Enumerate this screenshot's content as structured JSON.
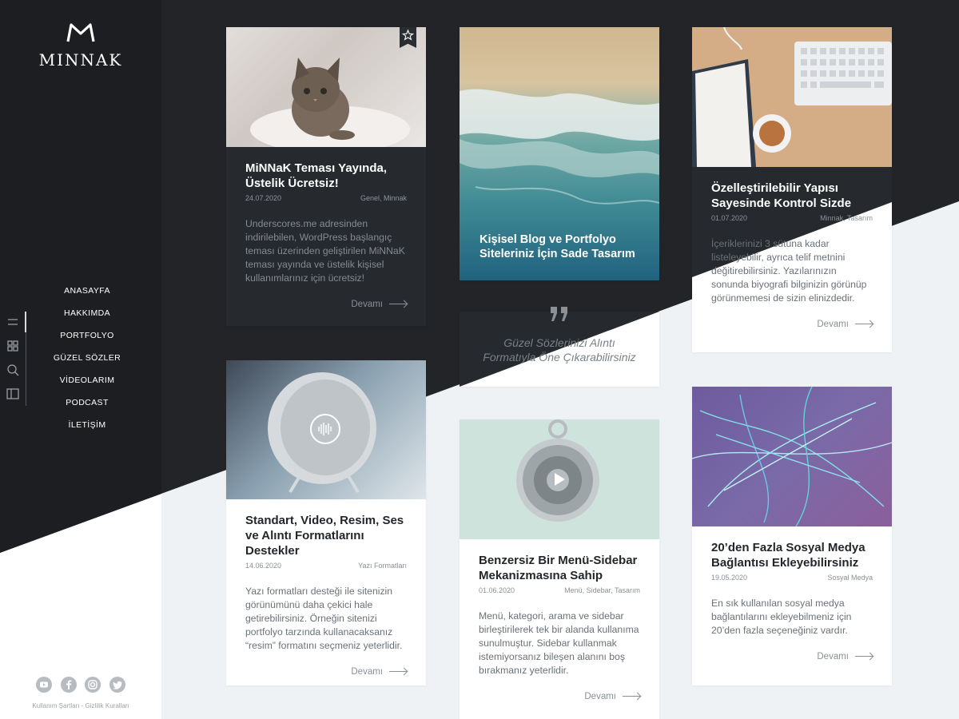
{
  "brand": {
    "name": "MINNAK"
  },
  "nav": [
    "ANASAYFA",
    "HAKKIMDA",
    "PORTFOLYO",
    "GÜZEL SÖZLER",
    "VİDEOLARIM",
    "PODCAST",
    "İLETİŞİM"
  ],
  "tools": [
    "menu-icon",
    "grid-icon",
    "search-icon",
    "sidebar-icon"
  ],
  "social": [
    "youtube-icon",
    "facebook-icon",
    "instagram-icon",
    "twitter-icon"
  ],
  "legal": "Kullanım Şartları - Gizlilik Kuralları",
  "more_label": "Devamı",
  "cards": {
    "c1": {
      "title": "MiNNaK Teması Yayında, Üstelik Ücretsiz!",
      "date": "24.07.2020",
      "cats": "Genel, Minnak",
      "excerpt": "Underscores.me adresinden indirilebilen, WordPress başlangıç teması üzerinden geliştirilen MiNNaK teması yayında ve üstelik kişisel kullanımlarınız için ücretsiz!"
    },
    "c2": {
      "title": "Kişisel Blog ve Portfolyo Siteleriniz İçin Sade Tasarım"
    },
    "c3": {
      "quote": "Güzel Sözlerinizi Alıntı Formatıyla Öne Çıkarabilirsiniz"
    },
    "c4": {
      "title": "Özelleştirilebilir Yapısı Sayesinde Kontrol Sizde",
      "date": "01.07.2020",
      "cats": "Minnak, Tasarım",
      "excerpt": "İçeriklerinizi 3 sütuna kadar listeleyebilir, ayrıca telif metnini değitirebilirsiniz. Yazılarınızın sonunda biyografi bilginizin görünüp görünmemesi de sizin elinizdedir."
    },
    "c5": {
      "title": "Standart, Video, Resim, Ses ve Alıntı Formatlarını Destekler",
      "date": "14.06.2020",
      "cats": "Yazı Formatları",
      "excerpt": "Yazı formatları desteği ile sitenizin görünümünü daha çekici hale getirebilirsiniz. Örneğin sitenizi portfolyo tarzında kullanacaksanız “resim” formatını seçmeniz yeterlidir."
    },
    "c6": {
      "title": "Benzersiz Bir Menü-Sidebar Mekanizmasına Sahip",
      "date": "01.06.2020",
      "cats": "Menü, Sidebar, Tasarım",
      "excerpt": "Menü, kategori, arama ve sidebar birleştirilerek tek bir alanda kullanıma sunulmuştur. Sidebar kullanmak istemiyorsanız bileşen alanını boş bırakmanız  yeterlidir."
    },
    "c7": {
      "title": "20’den Fazla Sosyal Medya Bağlantısı Ekleyebilirsiniz",
      "date": "19.05.2020",
      "cats": "Sosyal Medya",
      "excerpt": "En sık kullanılan sosyal medya bağlantılarını ekleyebilmeniz için 20’den fazla seçeneğiniz vardır."
    }
  },
  "colors": {
    "dark": "#222427",
    "sidebar": "#1c1e21",
    "light": "#eef2f5",
    "card_dark": "#26292d"
  }
}
